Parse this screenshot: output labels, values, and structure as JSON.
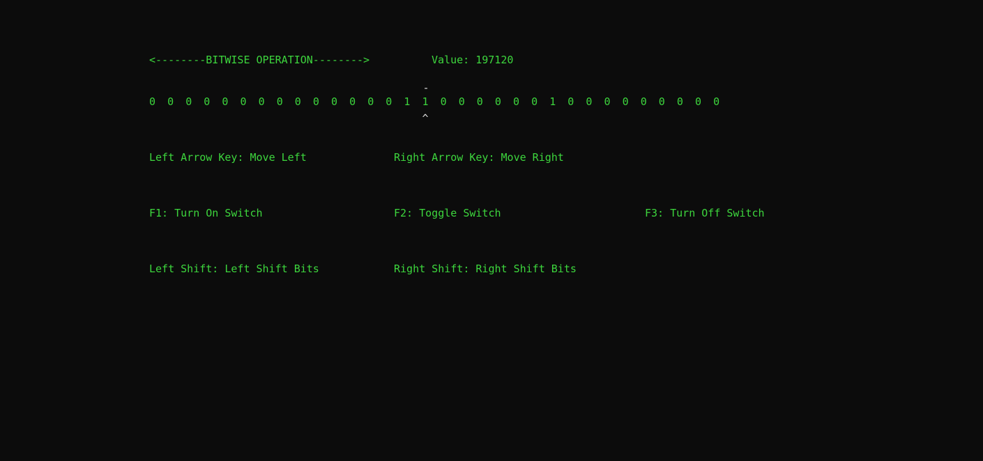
{
  "header": {
    "title": "<--------BITWISE OPERATION-------->",
    "value_label": "Value:",
    "value": "197120"
  },
  "cursor": {
    "top_marker": "-",
    "bottom_marker": "^",
    "selected_index": 15
  },
  "bits": [
    "0",
    "0",
    "0",
    "0",
    "0",
    "0",
    "0",
    "0",
    "0",
    "0",
    "0",
    "0",
    "0",
    "0",
    "1",
    "1",
    "0",
    "0",
    "0",
    "0",
    "0",
    "0",
    "1",
    "0",
    "0",
    "0",
    "0",
    "0",
    "0",
    "0",
    "0",
    "0"
  ],
  "help": {
    "move_left": "Left Arrow Key: Move Left",
    "move_right": "Right Arrow Key: Move Right",
    "f1": "F1: Turn On Switch",
    "f2": "F2: Toggle Switch",
    "f3": "F3: Turn Off Switch",
    "shift_left": "Left Shift: Left Shift Bits",
    "shift_right": "Right Shift: Right Shift Bits"
  },
  "colors": {
    "background": "#0c0c0c",
    "text": "#3dd63d",
    "cursor": "#d8d8d8"
  }
}
